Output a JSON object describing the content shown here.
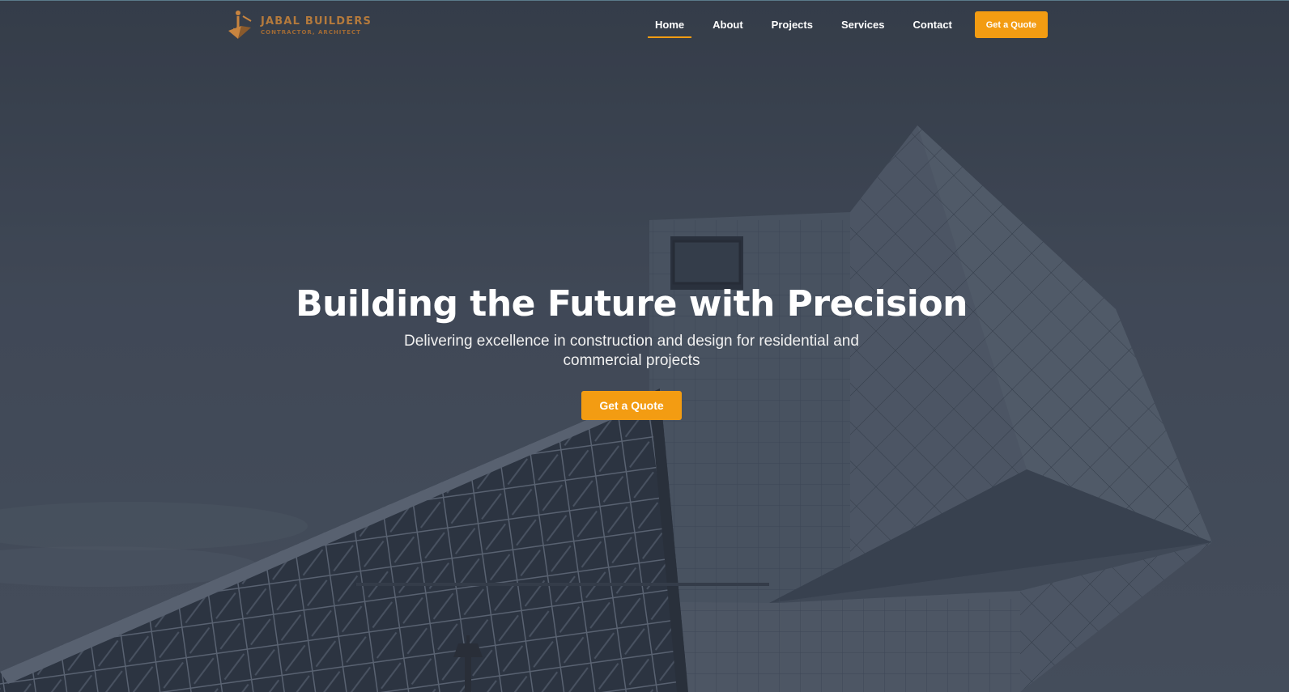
{
  "brand": {
    "name": "JABAL BUILDERS",
    "tagline": "CONTRACTOR, ARCHITECT",
    "logo_icon": "pyramid-person-icon"
  },
  "nav": {
    "items": [
      {
        "label": "Home",
        "active": true
      },
      {
        "label": "About",
        "active": false
      },
      {
        "label": "Projects",
        "active": false
      },
      {
        "label": "Services",
        "active": false
      },
      {
        "label": "Contact",
        "active": false
      }
    ],
    "cta_label": "Get a Quote"
  },
  "hero": {
    "title": "Building the Future with Precision",
    "subtitle": "Delivering excellence in construction and design for residential and commercial projects",
    "cta_label": "Get a Quote"
  },
  "colors": {
    "accent": "#f39c12",
    "logo": "#b47a3c",
    "overlay": "#3d4552",
    "text": "#ffffff"
  }
}
